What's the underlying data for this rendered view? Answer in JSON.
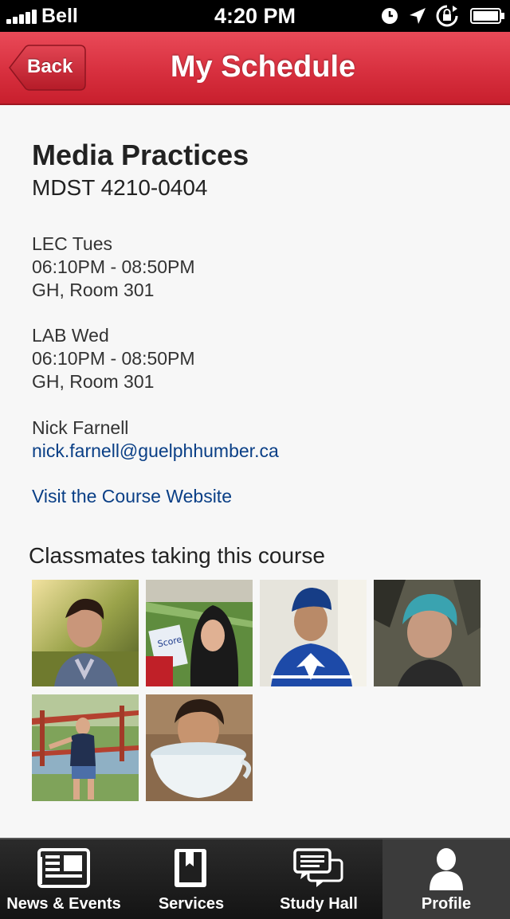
{
  "status_bar": {
    "carrier": "Bell",
    "time": "4:20 PM",
    "icons": [
      "signal-icon",
      "alarm-icon",
      "location-arrow-icon",
      "rotation-lock-icon",
      "battery-icon"
    ]
  },
  "nav": {
    "back_label": "Back",
    "title": "My Schedule"
  },
  "course": {
    "name": "Media Practices",
    "code": "MDST 4210-0404",
    "sessions": [
      {
        "type_day": "LEC Tues",
        "time": "06:10PM - 08:50PM",
        "location": "GH, Room 301"
      },
      {
        "type_day": "LAB Wed",
        "time": "06:10PM - 08:50PM",
        "location": "GH, Room 301"
      }
    ],
    "instructor": {
      "name": "Nick Farnell",
      "email": "nick.farnell@guelphhumber.ca"
    },
    "website_link": "Visit the Course Website"
  },
  "classmates": {
    "heading": "Classmates taking this course",
    "photos": [
      "classmate-photo",
      "classmate-photo",
      "classmate-photo",
      "classmate-photo",
      "classmate-photo",
      "classmate-photo"
    ]
  },
  "tabbar": {
    "tabs": [
      {
        "label": "News & Events",
        "icon": "newspaper-icon",
        "active": false
      },
      {
        "label": "Services",
        "icon": "book-icon",
        "active": false
      },
      {
        "label": "Study Hall",
        "icon": "chat-bubbles-icon",
        "active": false
      },
      {
        "label": "Profile",
        "icon": "person-icon",
        "active": true
      }
    ]
  },
  "colors": {
    "nav_red": "#d8303f",
    "link_blue": "#0a3f86",
    "tab_dark": "#1f1f1f"
  }
}
